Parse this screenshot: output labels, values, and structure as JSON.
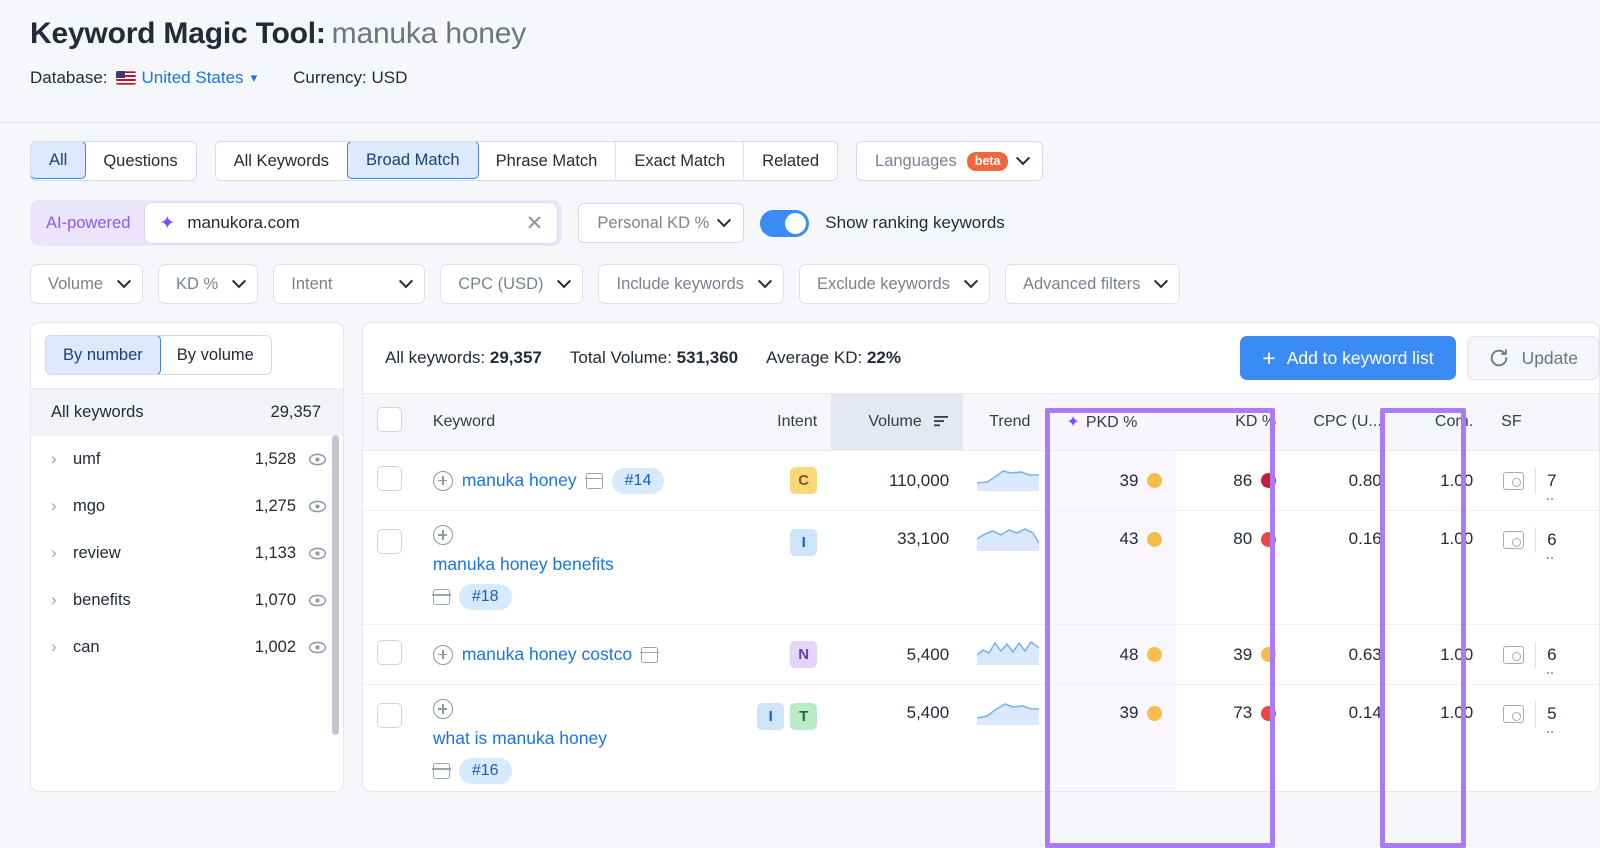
{
  "header": {
    "tool_title": "Keyword Magic Tool:",
    "keyword": "manuka honey",
    "database_label": "Database:",
    "database_value": "United States",
    "currency_label": "Currency: USD"
  },
  "tabs": {
    "group1": [
      {
        "label": "All",
        "active": true
      },
      {
        "label": "Questions",
        "active": false
      }
    ],
    "group2": [
      {
        "label": "All Keywords",
        "active": false
      },
      {
        "label": "Broad Match",
        "active": true
      },
      {
        "label": "Phrase Match",
        "active": false
      },
      {
        "label": "Exact Match",
        "active": false
      },
      {
        "label": "Related",
        "active": false
      }
    ],
    "languages_label": "Languages",
    "languages_badge": "beta"
  },
  "ai_row": {
    "ai_label": "AI-powered",
    "domain_value": "manukora.com",
    "personal_kd_label": "Personal KD %",
    "toggle_label": "Show ranking keywords",
    "toggle_on": true,
    "toggle_color": "#3b8bf5"
  },
  "filters": [
    {
      "label": "Volume"
    },
    {
      "label": "KD %"
    },
    {
      "label": "Intent"
    },
    {
      "label": "CPC (USD)"
    },
    {
      "label": "Include keywords"
    },
    {
      "label": "Exclude keywords"
    },
    {
      "label": "Advanced filters"
    }
  ],
  "sidebar": {
    "sort_tabs": [
      {
        "label": "By number",
        "active": true
      },
      {
        "label": "By volume",
        "active": false
      }
    ],
    "all_keywords_label": "All keywords",
    "all_keywords_count": "29,357",
    "items": [
      {
        "label": "umf",
        "count": "1,528"
      },
      {
        "label": "mgo",
        "count": "1,275"
      },
      {
        "label": "review",
        "count": "1,133"
      },
      {
        "label": "benefits",
        "count": "1,070"
      },
      {
        "label": "can",
        "count": "1,002"
      }
    ]
  },
  "table_header": {
    "all_keywords_label": "All keywords:",
    "all_keywords_value": "29,357",
    "total_volume_label": "Total Volume:",
    "total_volume_value": "531,360",
    "average_kd_label": "Average KD:",
    "average_kd_value": "22%",
    "add_button": "Add to keyword list",
    "update_button": "Update"
  },
  "columns": [
    {
      "key": "checkbox",
      "label": ""
    },
    {
      "key": "keyword",
      "label": "Keyword"
    },
    {
      "key": "intent",
      "label": "Intent"
    },
    {
      "key": "volume",
      "label": "Volume"
    },
    {
      "key": "trend",
      "label": "Trend"
    },
    {
      "key": "pkd",
      "label": "PKD %"
    },
    {
      "key": "kd",
      "label": "KD %"
    },
    {
      "key": "cpc",
      "label": "CPC (U..."
    },
    {
      "key": "com",
      "label": "Com."
    },
    {
      "key": "sf",
      "label": "SF"
    }
  ],
  "rows": [
    {
      "keyword": "manuka honey",
      "rank": "#14",
      "intent": [
        "C"
      ],
      "volume": "110,000",
      "pkd": "39",
      "pkd_color": "#f5bd4a",
      "kd": "86",
      "kd_color": "#c41e3a",
      "cpc": "0.80",
      "com": "1.00",
      "sf": "7"
    },
    {
      "keyword": "manuka honey benefits",
      "rank": "#18",
      "intent": [
        "I"
      ],
      "volume": "33,100",
      "pkd": "43",
      "pkd_color": "#f5bd4a",
      "kd": "80",
      "kd_color": "#ef4444",
      "cpc": "0.16",
      "com": "1.00",
      "sf": "6"
    },
    {
      "keyword": "manuka honey costco",
      "rank": "",
      "intent": [
        "N"
      ],
      "volume": "5,400",
      "pkd": "48",
      "pkd_color": "#f5bd4a",
      "kd": "39",
      "kd_color": "#f5bd4a",
      "cpc": "0.63",
      "com": "1.00",
      "sf": "6"
    },
    {
      "keyword": "what is manuka honey",
      "rank": "#16",
      "intent": [
        "I",
        "T"
      ],
      "volume": "5,400",
      "pkd": "39",
      "pkd_color": "#f5bd4a",
      "kd": "73",
      "kd_color": "#ef4444",
      "cpc": "0.14",
      "com": "1.00",
      "sf": "5"
    }
  ],
  "annotations": {
    "highlight_color": "#a97bf5",
    "boxes": [
      "pkd-kd-columns",
      "com-column"
    ]
  }
}
